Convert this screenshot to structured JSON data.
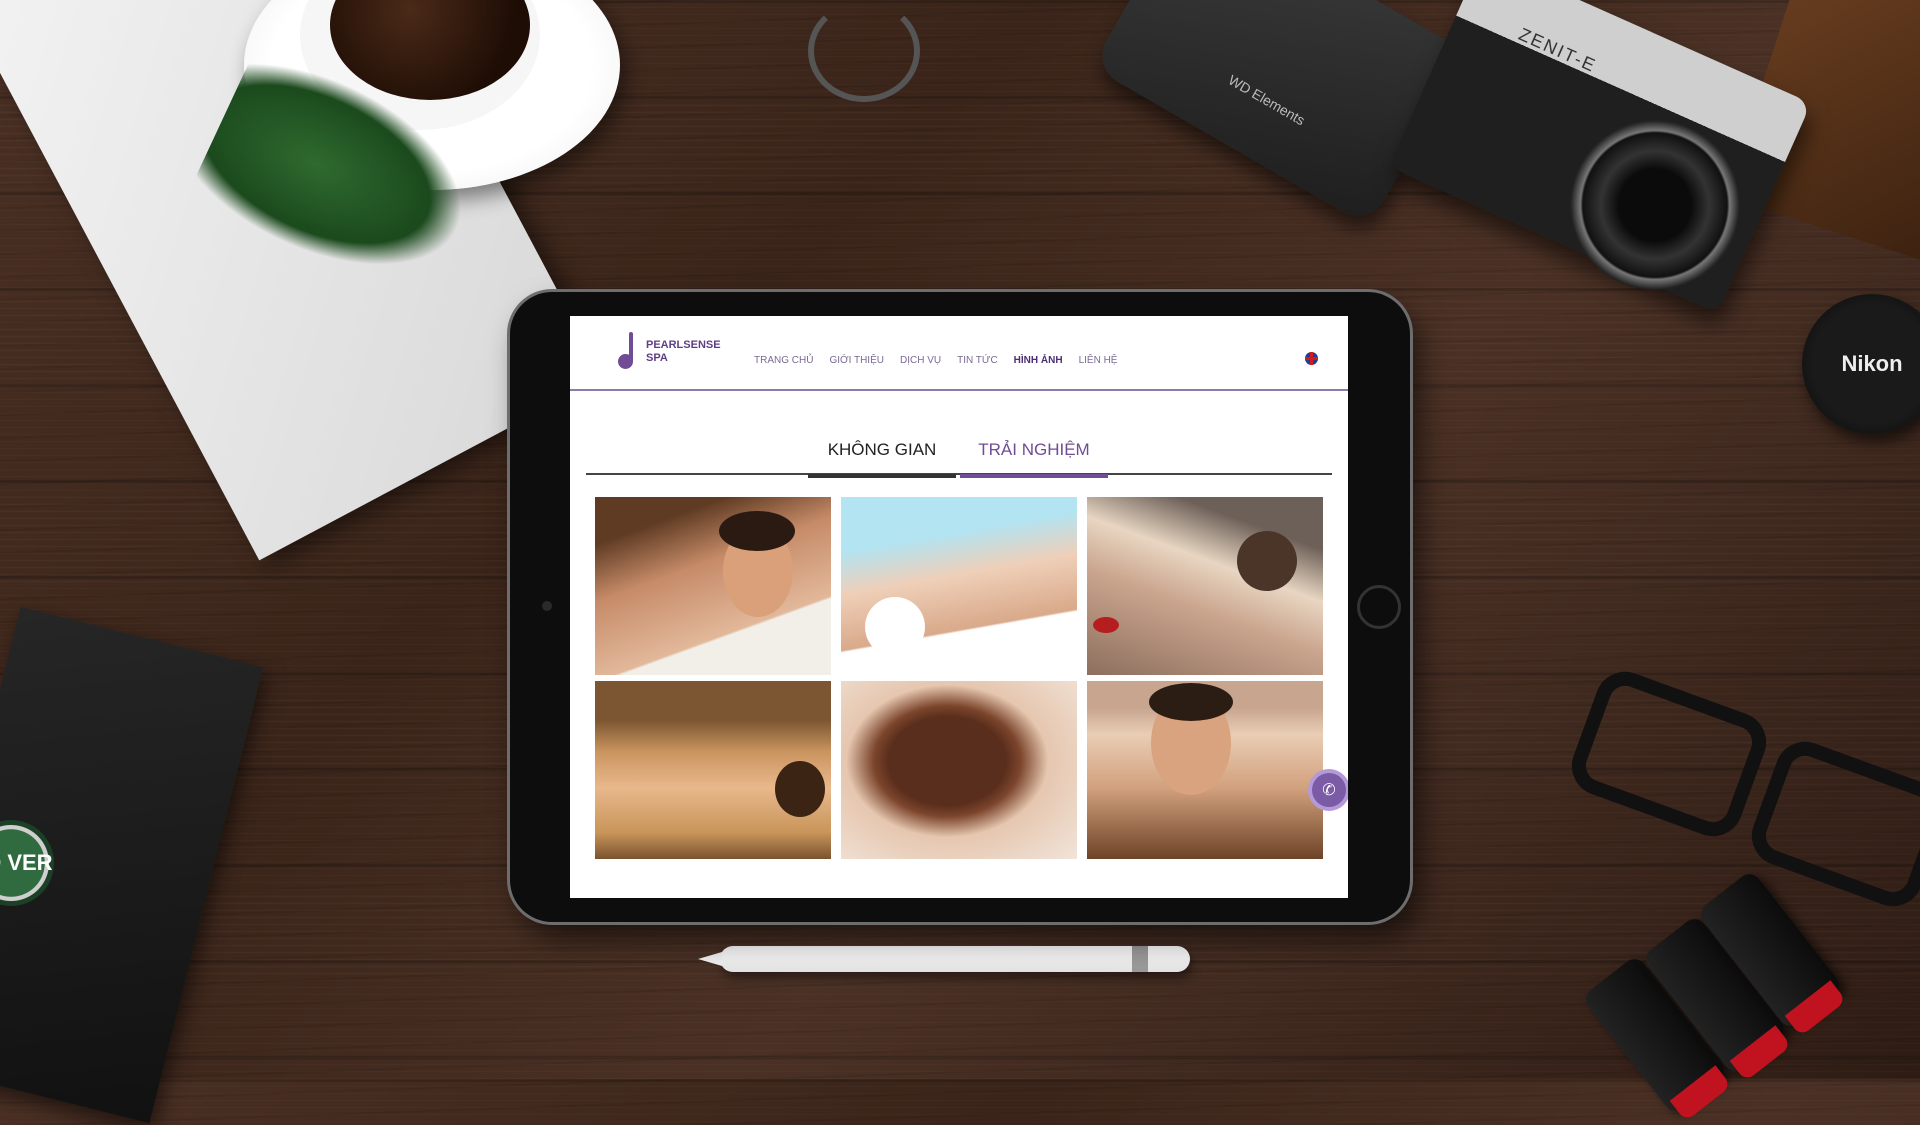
{
  "site": {
    "logo_line1": "PEARLSENSE",
    "logo_line2": "SPA"
  },
  "nav": {
    "items": [
      {
        "label": "TRANG CHỦ",
        "active": false
      },
      {
        "label": "GIỚI THIỆU",
        "active": false
      },
      {
        "label": "DỊCH VỤ",
        "active": false
      },
      {
        "label": "TIN TỨC",
        "active": false
      },
      {
        "label": "HÌNH ẢNH",
        "active": true
      },
      {
        "label": "LIÊN HỆ",
        "active": false
      }
    ],
    "language_icon": "uk-flag-icon"
  },
  "gallery": {
    "tabs": [
      {
        "label": "KHÔNG GIAN"
      },
      {
        "label": "TRẢI NGHIỆM"
      }
    ],
    "photos": [
      "man-back-massage-photo",
      "woman-facial-massage-photo",
      "hot-stone-massage-photo",
      "bamboo-massage-photo",
      "chocolate-body-wrap-photo",
      "man-face-massage-photo"
    ]
  },
  "props": {
    "hdd_label": "WD Elements",
    "camera_label": "ZENIT-E",
    "lens_cap_label": "Nikon",
    "badge_label": "ND\nVER"
  },
  "colors": {
    "brand_purple": "#6f4c95",
    "nav_text": "#7a6a94",
    "header_rule": "#8e7aa8"
  }
}
